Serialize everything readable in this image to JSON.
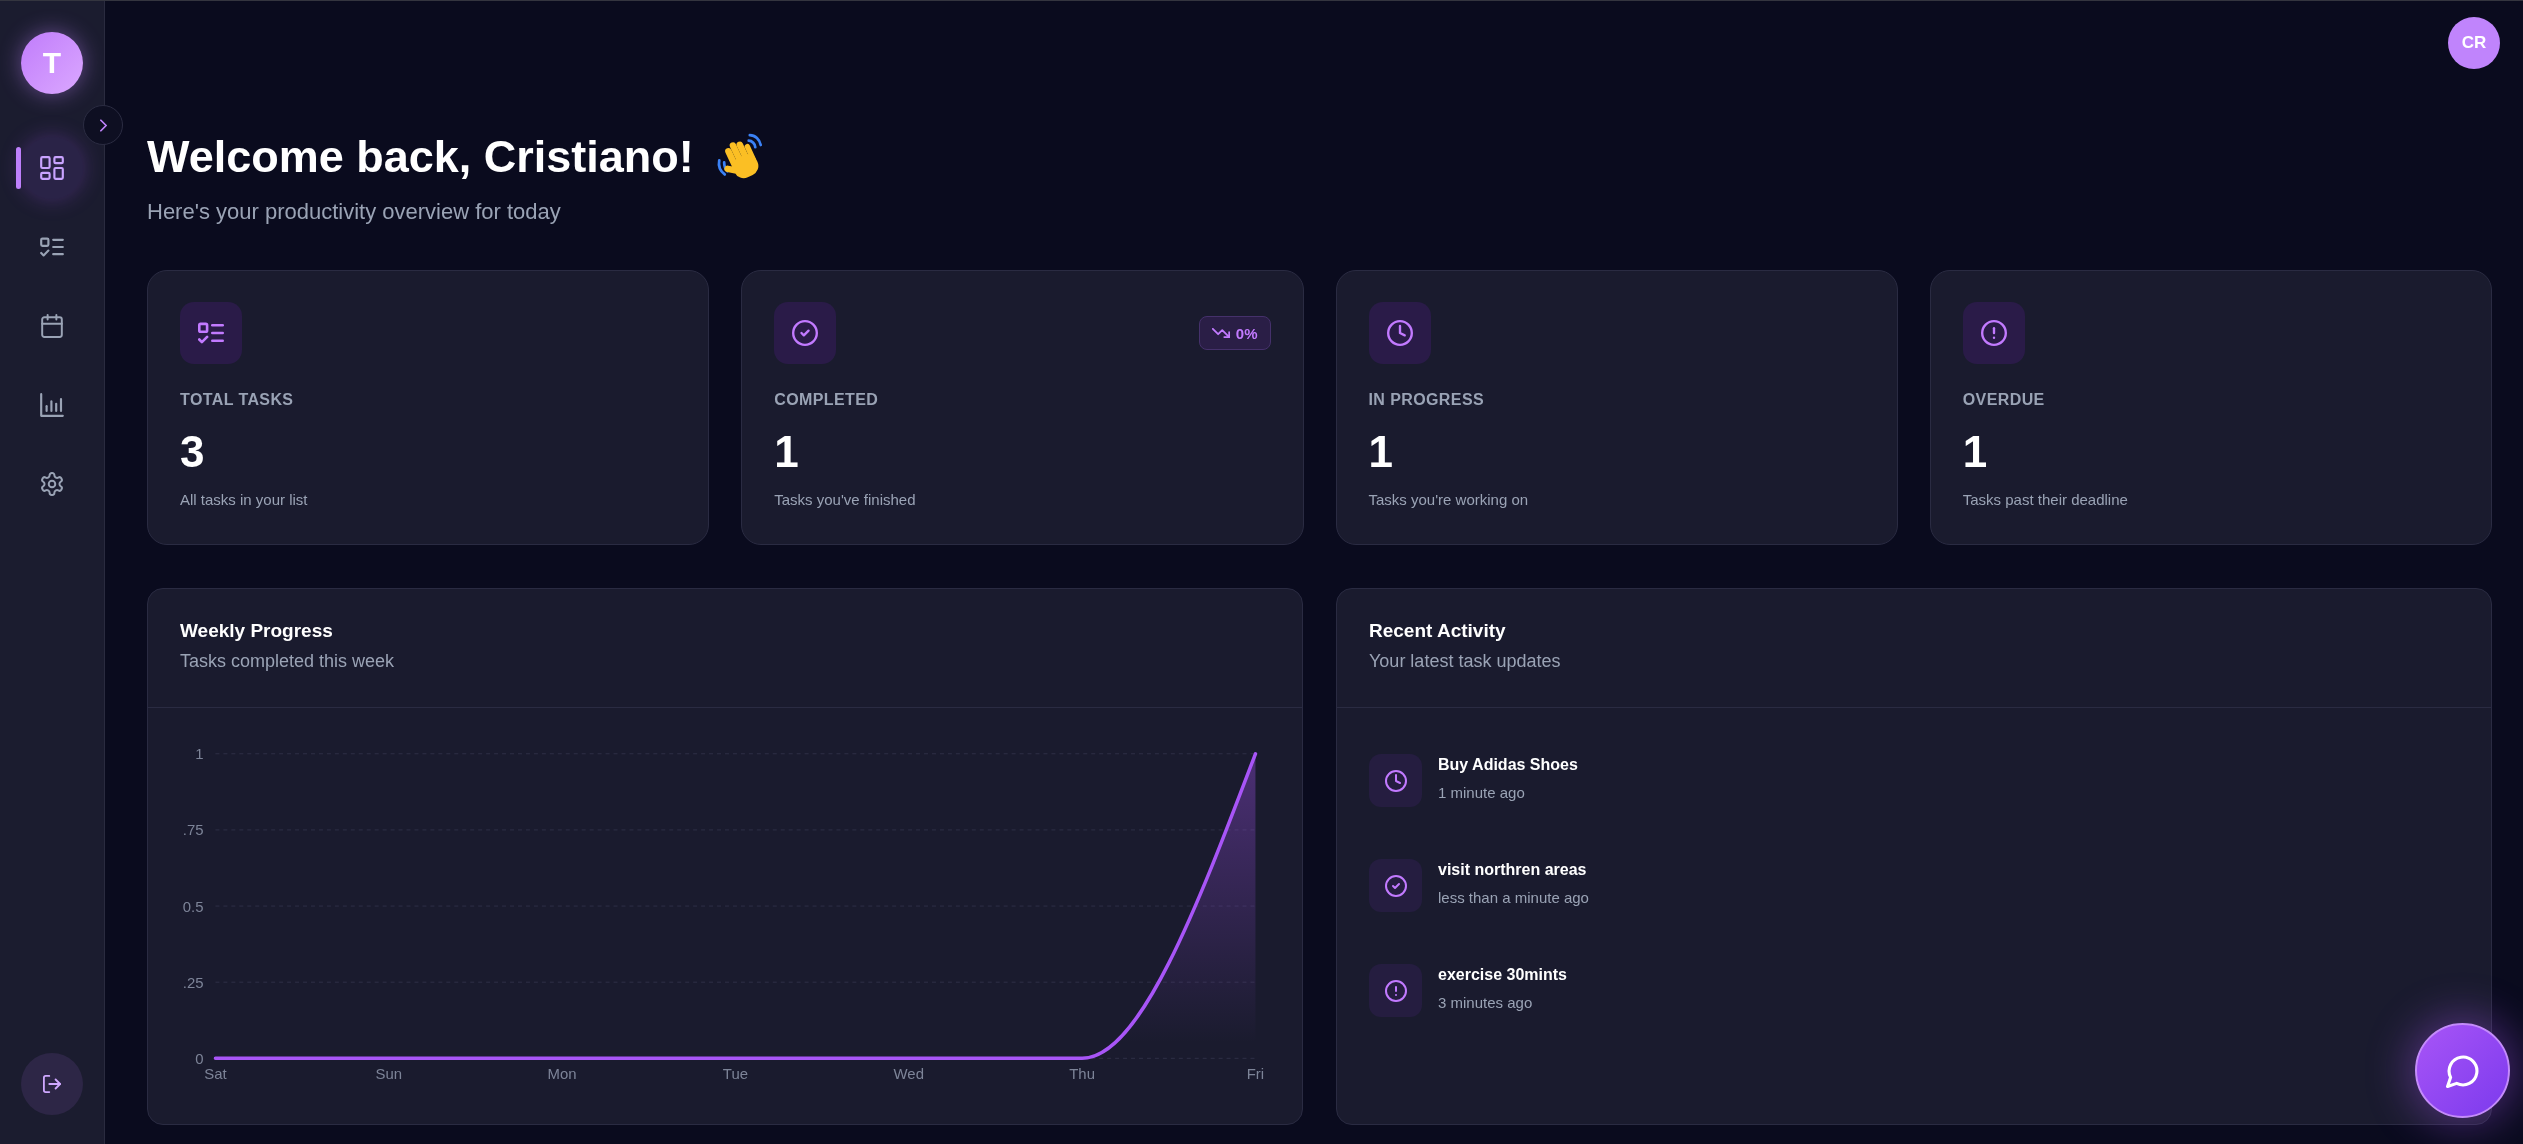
{
  "sidebar": {
    "logo": "T",
    "nav_items": [
      {
        "selected": true
      },
      {
        "selected": false
      },
      {
        "selected": false
      },
      {
        "selected": false
      },
      {
        "selected": false
      }
    ]
  },
  "header": {
    "avatar": "CR",
    "title": "Welcome back, Cristiano!",
    "subtitle": "Here's your productivity overview for today"
  },
  "stats": [
    {
      "kind": "total",
      "label": "TOTAL TASKS",
      "value": "3",
      "description": "All tasks in your list"
    },
    {
      "kind": "completed",
      "label": "COMPLETED",
      "value": "1",
      "description": "Tasks you've finished",
      "badge": {
        "kind": "trend_down",
        "text": "0%"
      }
    },
    {
      "kind": "in_progress",
      "label": "IN PROGRESS",
      "value": "1",
      "description": "Tasks you're working on"
    },
    {
      "kind": "overdue",
      "label": "OVERDUE",
      "value": "1",
      "description": "Tasks past their deadline"
    }
  ],
  "weekly_progress": {
    "title": "Weekly Progress",
    "subtitle": "Tasks completed this week",
    "chart_data": {
      "type": "area",
      "grid": true,
      "categories": [
        "Sat",
        "Sun",
        "Mon",
        "Tue",
        "Wed",
        "Thu",
        "Fri"
      ],
      "series": [
        {
          "color": "#a855f7",
          "values": [
            0,
            0,
            0,
            0,
            0,
            0,
            1
          ]
        }
      ],
      "ylim": [
        0,
        1
      ],
      "yticks": [
        0,
        {
          "value": 0.25,
          "label": ".25"
        },
        {
          "value": 0.5,
          "label": "0.5"
        },
        {
          "value": 0.75,
          "label": ".75"
        },
        1
      ]
    }
  },
  "recent_activity": {
    "title": "Recent Activity",
    "subtitle": "Your latest task updates",
    "items": [
      {
        "kind": "in_progress",
        "title": "Buy Adidas Shoes",
        "time": "1 minute ago"
      },
      {
        "kind": "completed",
        "title": "visit northren areas",
        "time": "less than a minute ago"
      },
      {
        "kind": "overdue",
        "title": "exercise 30mints",
        "time": "3 minutes ago"
      }
    ]
  }
}
